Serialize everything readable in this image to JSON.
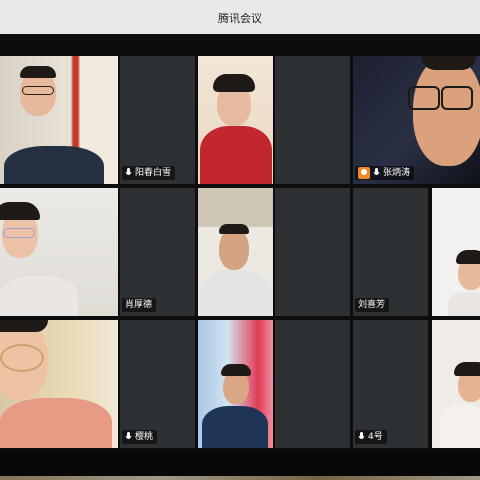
{
  "window": {
    "title": "腾讯会议"
  },
  "participants": [
    {
      "id": "p1",
      "name": "",
      "mic": false
    },
    {
      "id": "p2",
      "name": "阳春白雪",
      "mic": true
    },
    {
      "id": "p3",
      "name": "",
      "mic": false
    },
    {
      "id": "p4",
      "name": "",
      "mic": false
    },
    {
      "id": "p5",
      "name": "张炳涛",
      "mic": true,
      "host": true
    },
    {
      "id": "p6",
      "name": "",
      "mic": false
    },
    {
      "id": "p7",
      "name": "肖厚德",
      "mic": false
    },
    {
      "id": "p8",
      "name": "",
      "mic": false
    },
    {
      "id": "p9",
      "name": "刘喜芳",
      "mic": false
    },
    {
      "id": "p10",
      "name": "",
      "mic": false
    },
    {
      "id": "p11",
      "name": "",
      "mic": false
    },
    {
      "id": "p12",
      "name": "樱桃",
      "mic": true
    },
    {
      "id": "p13",
      "name": "",
      "mic": false
    },
    {
      "id": "p14",
      "name": "4号",
      "mic": true
    },
    {
      "id": "p15",
      "name": "",
      "mic": false
    }
  ],
  "icons": {
    "mic": "microphone-icon",
    "host": "host-badge-icon"
  },
  "colors": {
    "titlebar_bg": "#e9e9e9",
    "tile_bg": "#2f3235",
    "active_border": "#3a8f5e",
    "host_badge": "#f08a24"
  }
}
